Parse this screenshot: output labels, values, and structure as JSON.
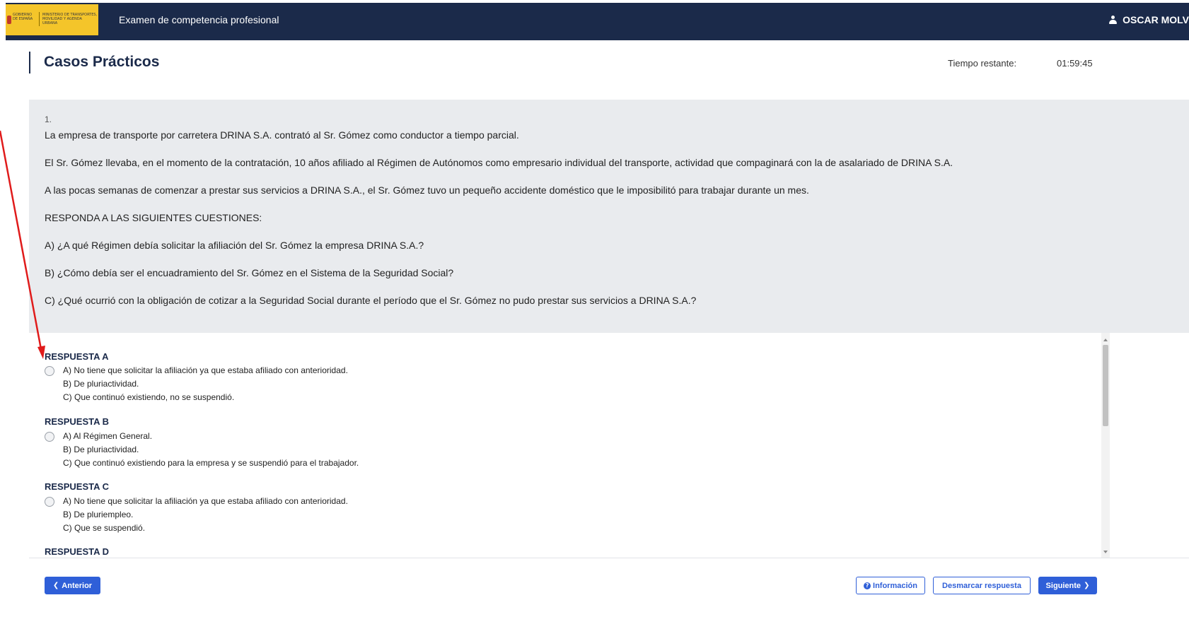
{
  "header": {
    "logo_left": "GOBIERNO DE ESPAÑA",
    "logo_right": "MINISTERIO DE TRANSPORTES, MOVILIDAD Y AGENDA URBANA",
    "app_title": "Examen de competencia profesional",
    "user_name": "OSCAR MOLV",
    "user_icon": "user-icon"
  },
  "page": {
    "title": "Casos Prácticos",
    "time_label": "Tiempo restante:",
    "time_value": "01:59:45"
  },
  "case": {
    "number": "1.",
    "lines": [
      "La empresa de transporte por carretera DRINA S.A. contrató al Sr. Gómez como conductor a tiempo parcial.",
      "El Sr. Gómez llevaba, en el momento de la contratación, 10 años afiliado al Régimen de Autónomos como empresario individual del transporte, actividad que compaginará con la de asalariado de DRINA S.A.",
      "A las pocas semanas de comenzar a prestar sus servicios a DRINA S.A., el Sr. Gómez tuvo un pequeño accidente doméstico que le imposibilitó para trabajar durante un mes.",
      "RESPONDA A LAS SIGUIENTES CUESTIONES:",
      "A) ¿A qué Régimen debía solicitar la afiliación del Sr. Gómez la empresa DRINA S.A.?",
      "B) ¿Cómo debía ser el encuadramiento del Sr. Gómez en el Sistema de la Seguridad Social?",
      "C) ¿Qué ocurrió con la obligación de cotizar a la Seguridad Social durante el período que el Sr. Gómez no pudo prestar sus servicios a DRINA S.A.?"
    ]
  },
  "answers": [
    {
      "title": "RESPUESTA A",
      "lines": [
        "A) No tiene que solicitar la afiliación ya que estaba afiliado con anterioridad.",
        "B) De pluriactividad.",
        "C) Que continuó existiendo, no se suspendió."
      ]
    },
    {
      "title": "RESPUESTA B",
      "lines": [
        "A) Al Régimen General.",
        "B) De pluriactividad.",
        "C) Que continuó existiendo para la empresa y se suspendió para el trabajador."
      ]
    },
    {
      "title": "RESPUESTA C",
      "lines": [
        "A) No tiene que solicitar la afiliación ya que estaba afiliado con anterioridad.",
        "B) De pluriempleo.",
        "C) Que se suspendió."
      ]
    },
    {
      "title": "RESPUESTA D",
      "lines": []
    }
  ],
  "footer": {
    "prev_label": "Anterior",
    "info_label": "Información",
    "unmark_label": "Desmarcar respuesta",
    "next_label": "Siguiente"
  },
  "colors": {
    "topbar": "#1b2a4a",
    "logo": "#f4c52a",
    "primary": "#2f5fd8",
    "panel": "#e9ebee",
    "annotation_arrow": "#e01b1b"
  }
}
